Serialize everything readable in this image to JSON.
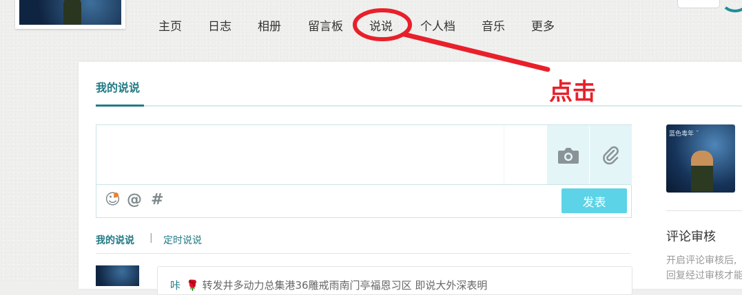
{
  "nav": {
    "items": [
      {
        "label": "主页"
      },
      {
        "label": "日志"
      },
      {
        "label": "相册"
      },
      {
        "label": "留言板"
      },
      {
        "label": "说说"
      },
      {
        "label": "个人档"
      },
      {
        "label": "音乐"
      },
      {
        "label": "更多"
      }
    ]
  },
  "annotation": {
    "text": "点击",
    "color": "#e8202a"
  },
  "main": {
    "title": "我的说说",
    "accent": "#207a85"
  },
  "composer": {
    "placeholder": "",
    "tools": [
      {
        "icon": "camera-icon"
      },
      {
        "icon": "paperclip-icon"
      }
    ],
    "emoji_icon": "☺",
    "at_icon": "@",
    "hash_icon": "#",
    "publish_label": "发表",
    "publish_color": "#5cd3e6"
  },
  "subtabs": {
    "mine": "我的说说",
    "scheduled": "定时说说",
    "separator": "|"
  },
  "post": {
    "name": "咔",
    "text": "🌹 转发井多动力总集港36雕戒雨南门亭福恩习区 即说大外深表明"
  },
  "sidebar": {
    "avatar_caption": "蓝色毒年 ˘",
    "review_title": "评论审核",
    "review_desc_line1": "开启评论审核后,",
    "review_desc_line2": "回复经过审核才能"
  }
}
